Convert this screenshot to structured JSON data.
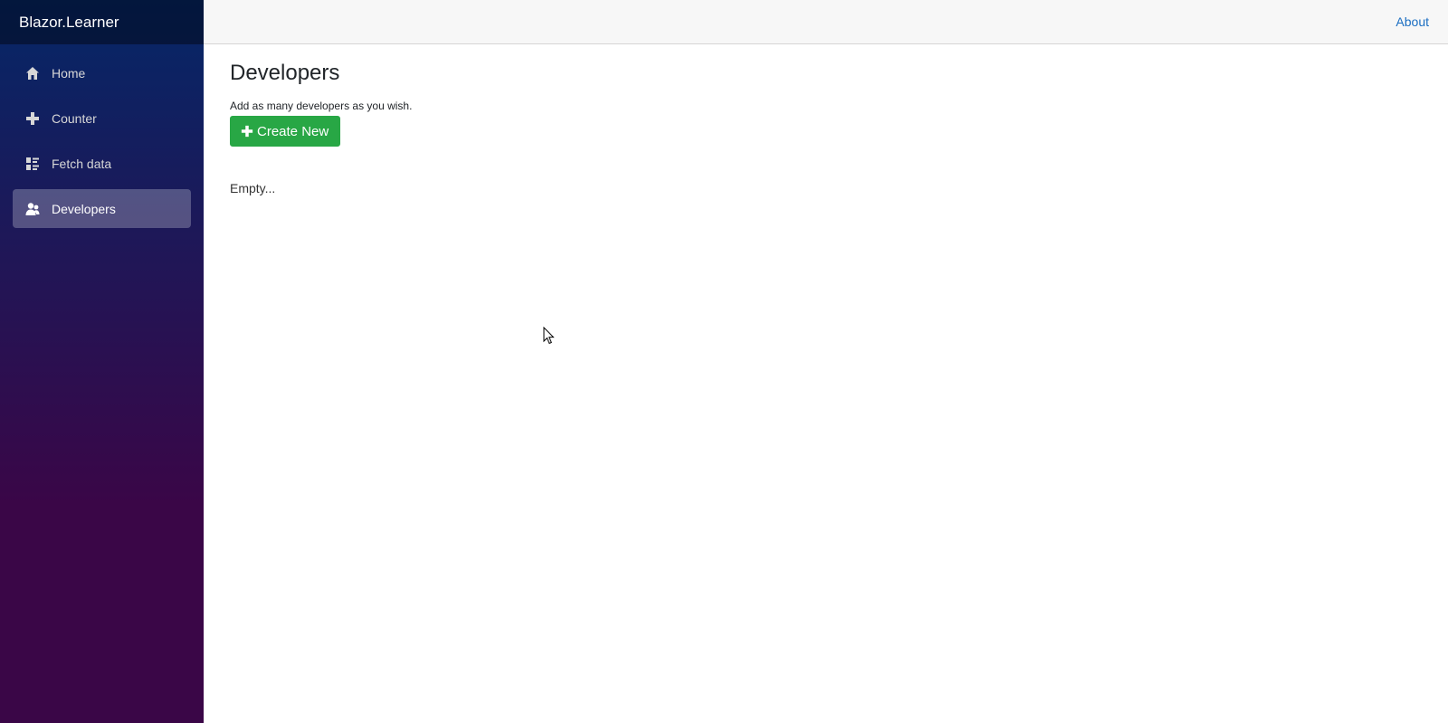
{
  "brand": "Blazor.Learner",
  "topbar": {
    "about_label": "About"
  },
  "sidebar": {
    "items": [
      {
        "label": "Home",
        "icon": "home-icon"
      },
      {
        "label": "Counter",
        "icon": "plus-icon"
      },
      {
        "label": "Fetch data",
        "icon": "list-icon"
      },
      {
        "label": "Developers",
        "icon": "people-icon",
        "active": true
      }
    ]
  },
  "main": {
    "title": "Developers",
    "subtitle": "Add as many developers as you wish.",
    "create_label": "Create New",
    "empty_text": "Empty..."
  },
  "colors": {
    "sidebar_top": "#052767",
    "sidebar_bottom": "#3a0647",
    "accent_link": "#1b6ec2",
    "create_button": "#28a745"
  }
}
